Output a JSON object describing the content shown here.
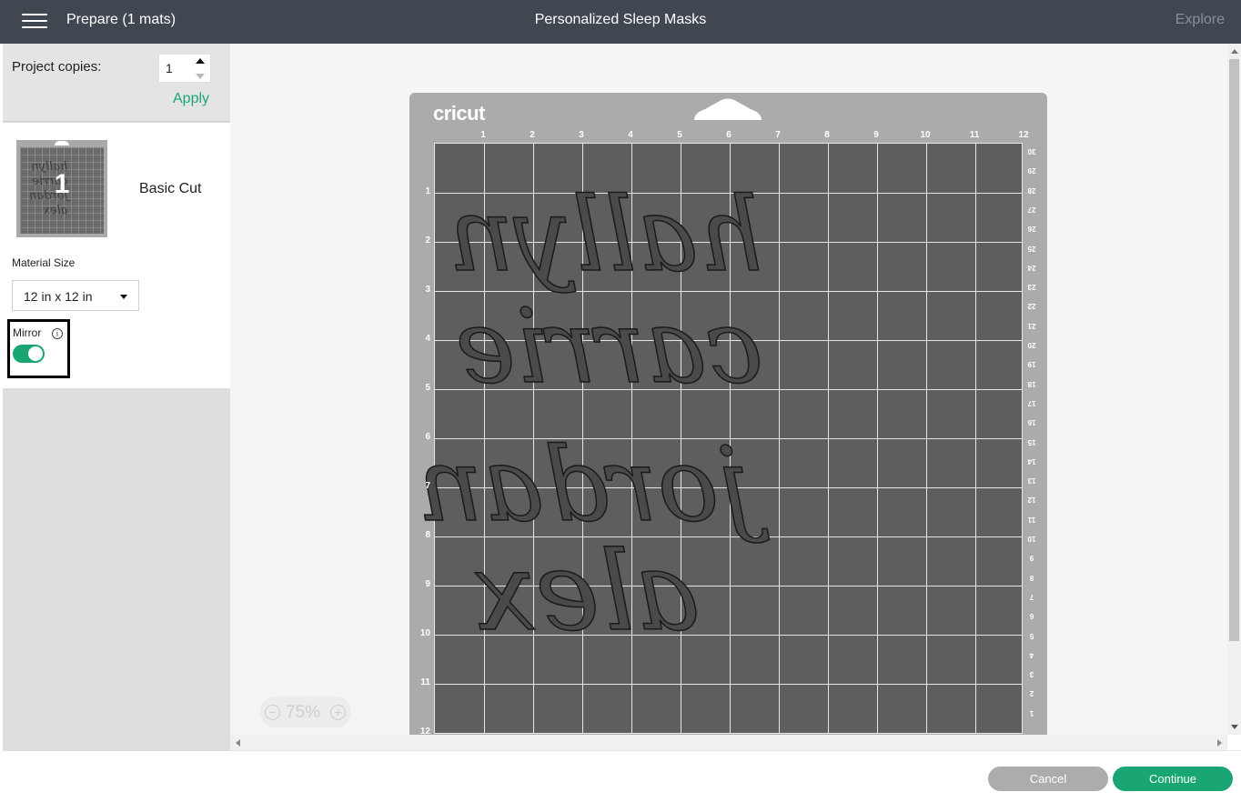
{
  "header": {
    "title": "Prepare (1 mats)",
    "project_name": "Personalized Sleep Masks",
    "explore_label": "Explore"
  },
  "sidebar": {
    "copies_label": "Project copies:",
    "copies_value": "1",
    "apply_label": "Apply",
    "mat_number": "1",
    "mat_mode": "Basic Cut",
    "material_size_label": "Material Size",
    "material_size_value": "12 in x 12 in",
    "mirror_label": "Mirror",
    "mirror_on": true
  },
  "mat": {
    "logo": "cricut",
    "col_labels": [
      "1",
      "2",
      "3",
      "4",
      "5",
      "6",
      "7",
      "8",
      "9",
      "10",
      "11",
      "12"
    ],
    "row_labels": [
      "1",
      "2",
      "3",
      "4",
      "5",
      "6",
      "7",
      "8",
      "9",
      "10",
      "11",
      "12"
    ],
    "right_labels": [
      "30",
      "29",
      "28",
      "27",
      "26",
      "25",
      "24",
      "23",
      "22",
      "21",
      "20",
      "19",
      "18",
      "17",
      "16",
      "15",
      "14",
      "13",
      "12",
      "11",
      "10",
      "9",
      "8",
      "7",
      "6",
      "5",
      "4",
      "3",
      "2",
      "1"
    ],
    "names": [
      "hallyn",
      "carrie",
      "jordan",
      "alex"
    ]
  },
  "zoom": {
    "value": "75%"
  },
  "footer": {
    "cancel_label": "Cancel",
    "continue_label": "Continue"
  },
  "colors": {
    "accent": "#1aa672",
    "topbar": "#414750",
    "mat": "#ababab",
    "cut_area": "#5e5e5e"
  }
}
